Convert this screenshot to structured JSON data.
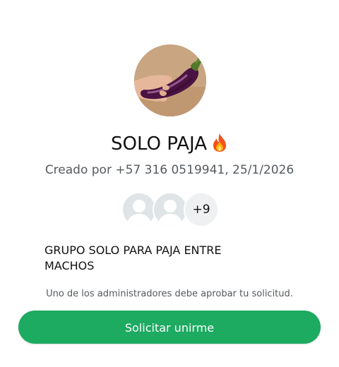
{
  "group": {
    "name": "SOLO PAJA",
    "name_emoji": "fire-icon",
    "created_by_label": "Creado por",
    "creator_phone": "+57 316 0519941",
    "created_date": "25/1/2026",
    "photo": "eggplant-in-hand-photo",
    "description": "GRUPO SOLO PARA PAJA ENTRE MACHOS"
  },
  "members": {
    "avatars": [
      "default-avatar-icon",
      "default-avatar-icon"
    ],
    "more_count": "+9"
  },
  "notice": {
    "approval_text": "Uno de los administradores debe aprobar tu solicitud."
  },
  "actions": {
    "join_label": "Solicitar unirme"
  },
  "colors": {
    "accent": "#1daa61",
    "avatar_bg": "#dfe5e7"
  }
}
